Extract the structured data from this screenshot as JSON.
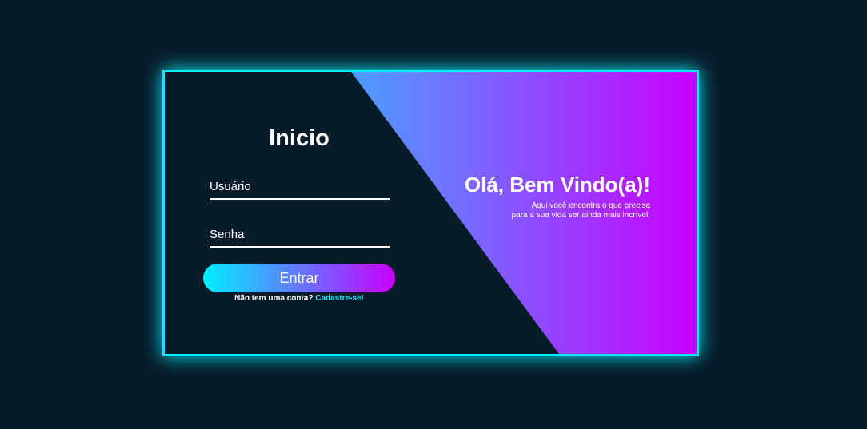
{
  "login": {
    "title": "Inicio",
    "username_placeholder": "Usuário",
    "password_placeholder": "Senha",
    "submit_label": "Entrar",
    "no_account_text": "Não tem uma conta?",
    "signup_link": "Cadastre-se!"
  },
  "welcome": {
    "title": "Olá, Bem Vindo(a)!",
    "line1": "Aqui você encontra o que precisa",
    "line2": "para a sua vida ser ainda mais incrível."
  },
  "colors": {
    "background": "#081b29",
    "accent_cyan": "#00eeff",
    "accent_purple": "#c800ff",
    "text": "#ffffff"
  }
}
